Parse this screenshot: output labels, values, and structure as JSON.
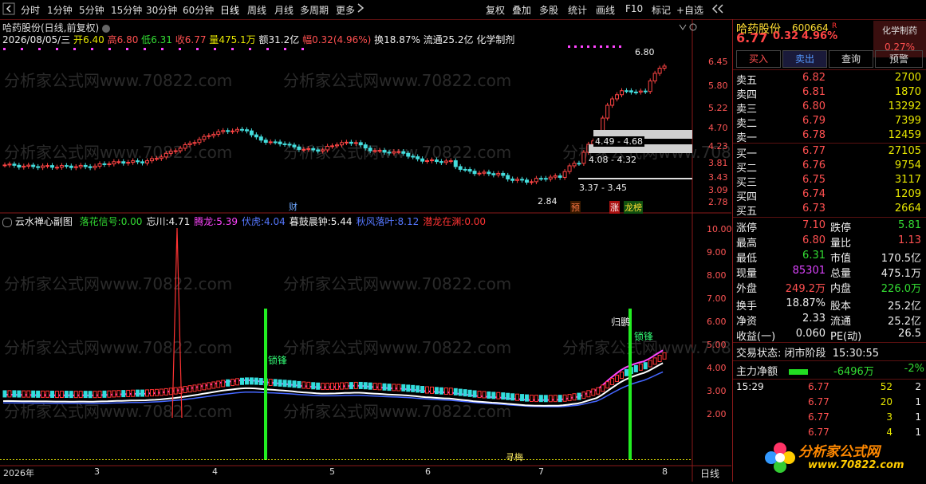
{
  "toolbar": {
    "left": [
      "分时",
      "1分钟",
      "5分钟",
      "15分钟",
      "30分钟",
      "60分钟",
      "日线",
      "周线",
      "月线",
      "多周期",
      "更多"
    ],
    "right": [
      "复权",
      "叠加",
      "多股",
      "统计",
      "画线",
      "F10",
      "标记",
      "+自选"
    ],
    "back_icon": "back-arrow-icon",
    "more_icon": "chevron-right-icon"
  },
  "main_chart": {
    "title": "哈药股份(日线,前复权)",
    "info": {
      "date": "2026/08/05/三",
      "open_label": "开",
      "open": "6.40",
      "high_label": "高",
      "high": "6.80",
      "low_label": "低",
      "low": "6.31",
      "close_label": "收",
      "close": "6.77",
      "volume_label": "量",
      "volume": "475.1万",
      "amount_label": "额",
      "amount": "31.2亿",
      "change_label": "幅",
      "change": "0.32(4.96%)",
      "turnover_label": "换",
      "turnover": "18.87%",
      "float_label": "流通",
      "float": "25.2亿",
      "sector": "化学制剂"
    },
    "y_ticks": [
      "6.45",
      "5.80",
      "5.22",
      "4.70",
      "4.23",
      "3.81",
      "3.43",
      "3.09",
      "2.78"
    ],
    "annotations": {
      "high_mark": "6.80",
      "low_mark": "2.84",
      "zones": [
        "4.49 - 4.68",
        "4.08 - 4.32",
        "3.37 - 3.45"
      ],
      "tags": [
        "财",
        "预",
        "涨",
        "龙榜"
      ]
    }
  },
  "indicator": {
    "name": "云水禅心副图",
    "legend": [
      {
        "label": "落花信号:",
        "value": "0.00",
        "color": "#33dd33"
      },
      {
        "label": "忘川:",
        "value": "4.71",
        "color": "#eeeeee"
      },
      {
        "label": "腾龙:",
        "value": "5.39",
        "color": "#ff44ff"
      },
      {
        "label": "伏虎:",
        "value": "4.04",
        "color": "#5577ff"
      },
      {
        "label": "暮鼓晨钟:",
        "value": "5.44",
        "color": "#eeeeee"
      },
      {
        "label": "秋风落叶:",
        "value": "8.12",
        "color": "#5577ff"
      },
      {
        "label": "潜龙在渊:",
        "value": "0.00",
        "color": "#ff3333"
      }
    ],
    "y_ticks": [
      "10.00",
      "9.00",
      "8.00",
      "7.00",
      "6.00",
      "5.00",
      "4.00",
      "3.00",
      "2.00"
    ],
    "signals": [
      "锁锋",
      "锁锋",
      "归鹏",
      "寻梅"
    ],
    "x_labels": [
      "2026年",
      "3",
      "4",
      "5",
      "6",
      "7",
      "8"
    ],
    "period": "日线"
  },
  "watermark": "分析家公式网www.70822.com",
  "quote": {
    "name": "哈药股份",
    "code": "600664",
    "flag": "R",
    "sector": "化学制药",
    "sector_change": "0.27%",
    "price": "6.77",
    "change": "0.32",
    "pct": "4.96%",
    "buttons": [
      "买入",
      "卖出",
      "查询",
      "预警"
    ],
    "asks": [
      {
        "label": "卖五",
        "price": "6.82",
        "vol": "2700"
      },
      {
        "label": "卖四",
        "price": "6.81",
        "vol": "1870"
      },
      {
        "label": "卖三",
        "price": "6.80",
        "vol": "13292"
      },
      {
        "label": "卖二",
        "price": "6.79",
        "vol": "7399"
      },
      {
        "label": "卖一",
        "price": "6.78",
        "vol": "12459"
      }
    ],
    "bids": [
      {
        "label": "买一",
        "price": "6.77",
        "vol": "27105"
      },
      {
        "label": "买二",
        "price": "6.76",
        "vol": "9754"
      },
      {
        "label": "买三",
        "price": "6.75",
        "vol": "3117"
      },
      {
        "label": "买四",
        "price": "6.74",
        "vol": "1209"
      },
      {
        "label": "买五",
        "price": "6.73",
        "vol": "2664"
      }
    ],
    "stats": [
      {
        "l1": "涨停",
        "v1": "7.10",
        "c1": "red",
        "l2": "跌停",
        "v2": "5.81",
        "c2": "green"
      },
      {
        "l1": "最高",
        "v1": "6.80",
        "c1": "red",
        "l2": "量比",
        "v2": "1.13",
        "c2": "red"
      },
      {
        "l1": "最低",
        "v1": "6.31",
        "c1": "green",
        "l2": "市值",
        "v2": "170.5亿",
        "c2": "white"
      },
      {
        "l1": "现量",
        "v1": "85301",
        "c1": "purple",
        "l2": "总量",
        "v2": "475.1万",
        "c2": "white"
      },
      {
        "l1": "外盘",
        "v1": "249.2万",
        "c1": "red",
        "l2": "内盘",
        "v2": "226.0万",
        "c2": "green"
      },
      {
        "l1": "换手",
        "v1": "18.87%",
        "c1": "white",
        "l2": "股本",
        "v2": "25.2亿",
        "c2": "white"
      },
      {
        "l1": "净资",
        "v1": "2.33",
        "c1": "white",
        "l2": "流通",
        "v2": "25.2亿",
        "c2": "white"
      },
      {
        "l1": "收益(一)",
        "v1": "0.060",
        "c1": "white",
        "l2": "PE(动)",
        "v2": "26.5",
        "c2": "white"
      }
    ],
    "trade_status_label": "交易状态:",
    "trade_status": "闭市阶段",
    "trade_time": "15:30:55",
    "netflow_label": "主力净额",
    "netflow": "-6496万",
    "netflow_pct": "-2%",
    "ticks": [
      {
        "time": "15:29",
        "price": "6.77",
        "vol": "52",
        "n": "2"
      },
      {
        "time": "",
        "price": "6.77",
        "vol": "20",
        "n": "1"
      },
      {
        "time": "",
        "price": "6.77",
        "vol": "3",
        "n": "1"
      },
      {
        "time": "",
        "price": "6.77",
        "vol": "4",
        "n": "1"
      }
    ],
    "logo_text": "分析家公式网",
    "logo_url": "www.70822.com"
  }
}
